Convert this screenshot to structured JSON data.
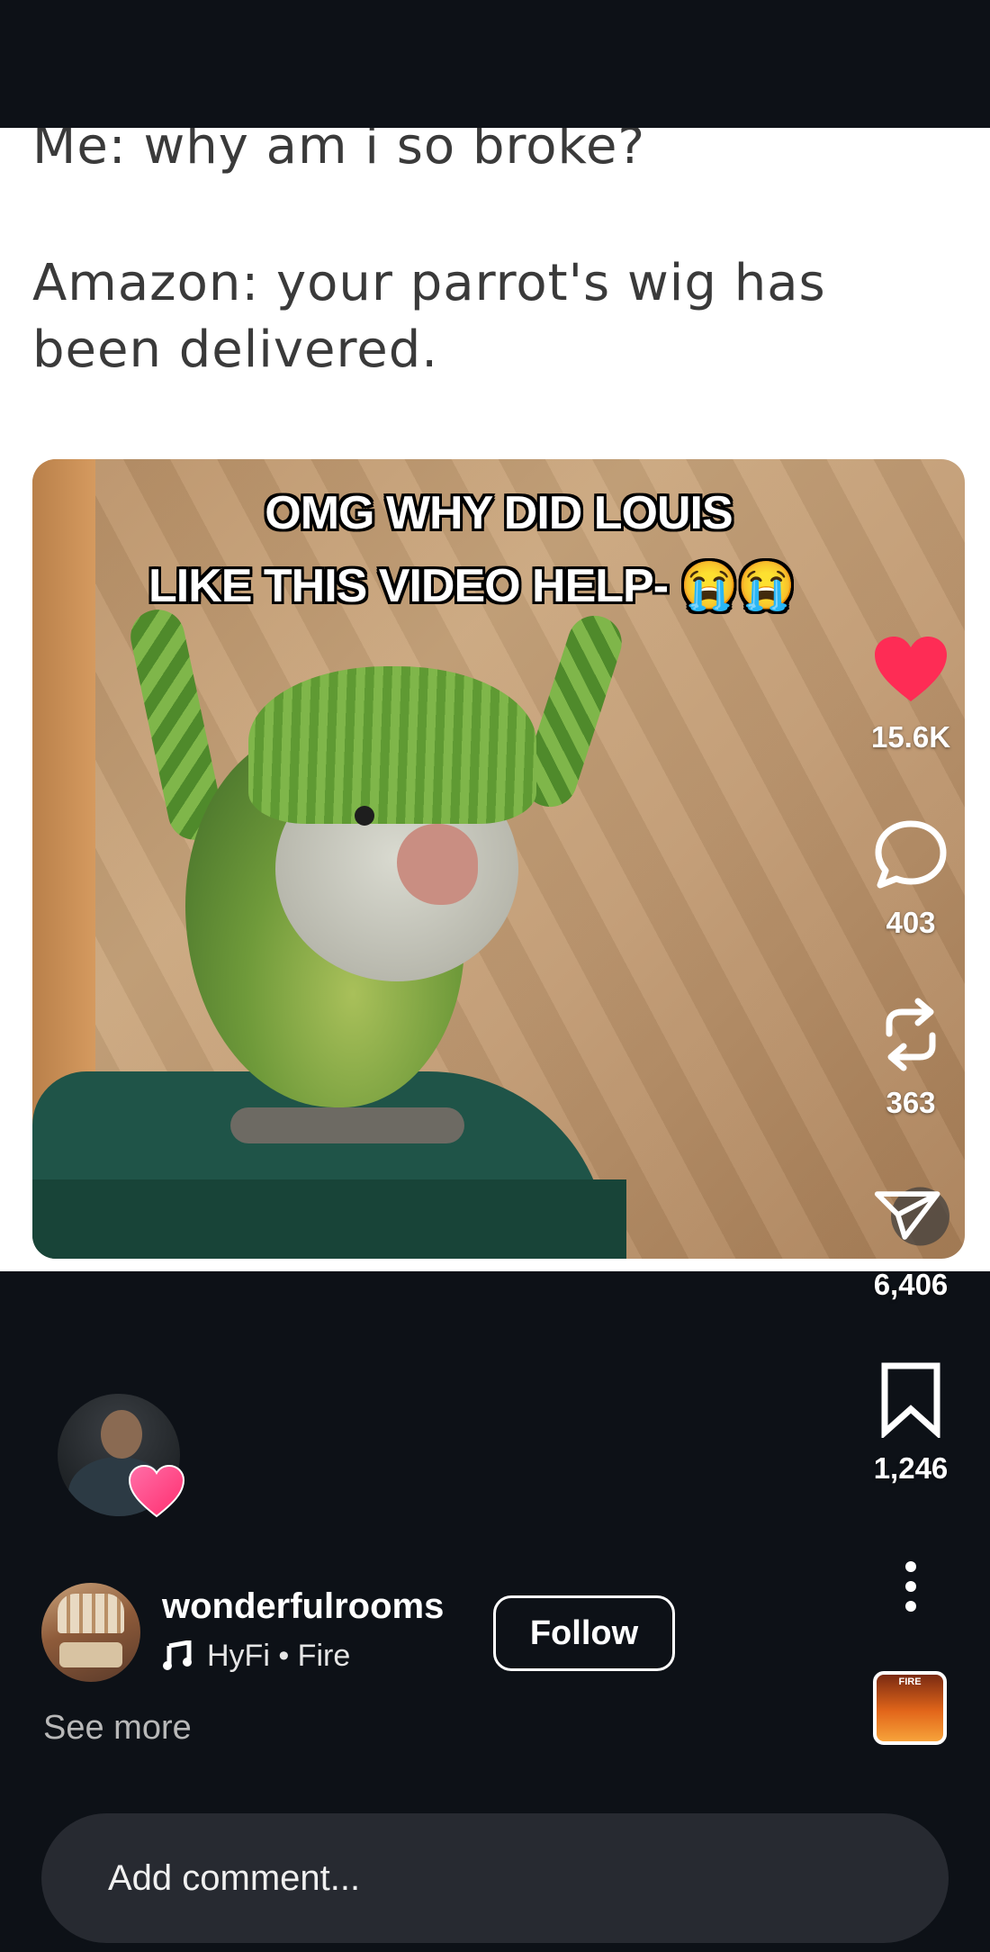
{
  "meme": {
    "line1": "Me: why am i so broke?",
    "line2a": "Amazon: your parrot's wig has",
    "line2b": "been delivered."
  },
  "video": {
    "caption_line1": "OMG WHY DID LOUIS",
    "caption_line2": "LIKE THIS VIDEO HELP- 😭😭",
    "progress": 0.3
  },
  "actions": {
    "likes": "15.6K",
    "comments": "403",
    "reposts": "363",
    "shares": "6,406",
    "saves": "1,246",
    "like_color": "#fe2c55"
  },
  "post": {
    "username": "wonderfulrooms",
    "music": "HyFi • Fire",
    "follow_label": "Follow",
    "see_more": "See more",
    "album_label": "FIRE"
  },
  "comment": {
    "placeholder": "Add comment..."
  }
}
